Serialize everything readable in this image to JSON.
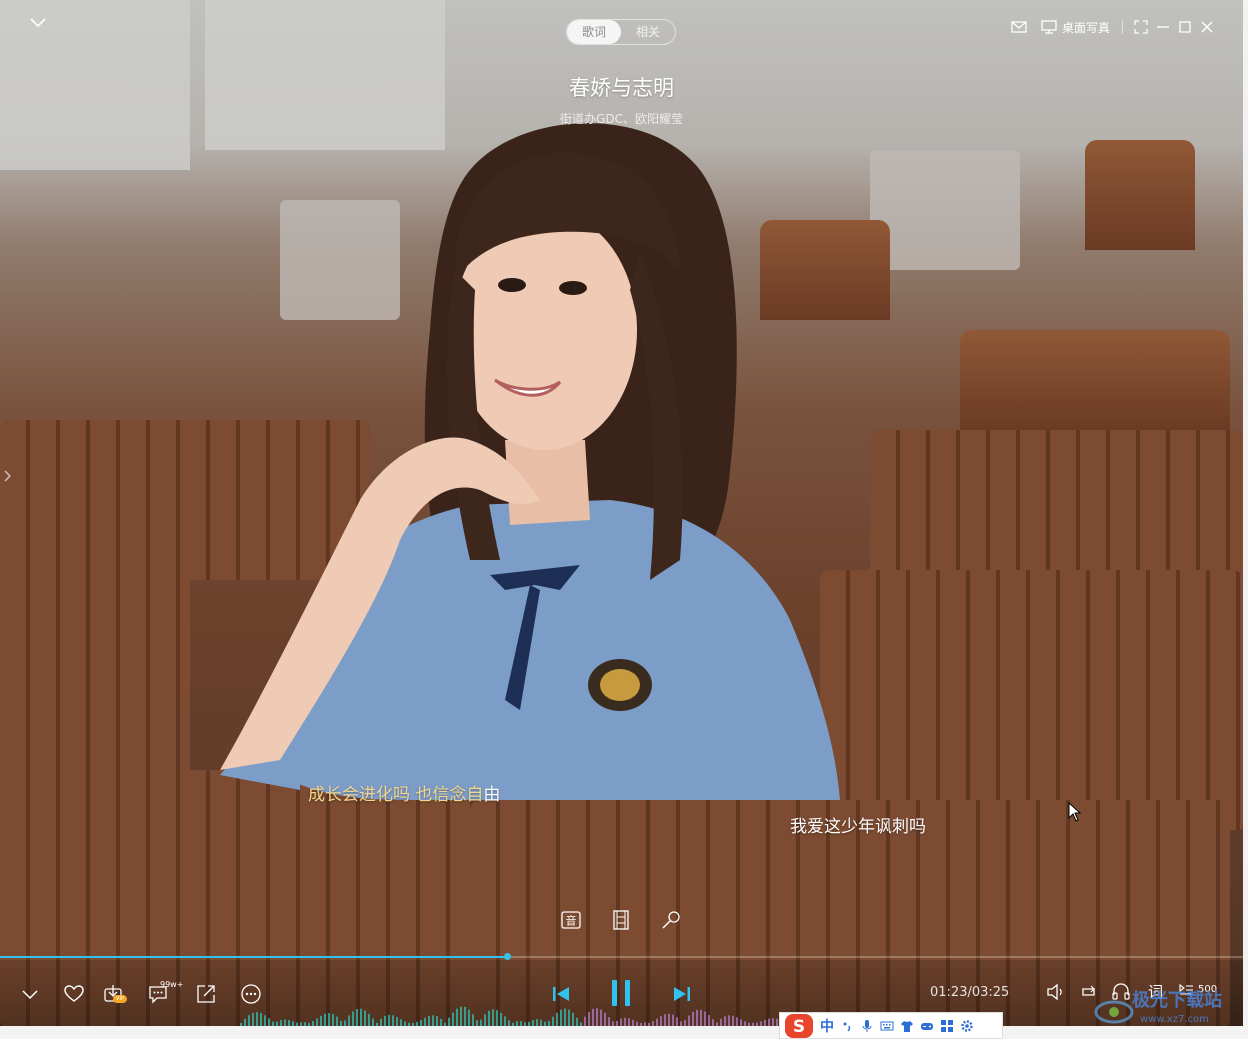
{
  "header": {
    "tabs": [
      {
        "label": "歌词",
        "active": true
      },
      {
        "label": "相关",
        "active": false
      }
    ],
    "desktop_label": "桌面写真"
  },
  "song": {
    "title": "春娇与志明",
    "artist": "街道办GDC、欧阳耀莹"
  },
  "lyrics": {
    "current_highlighted": "成长会进化吗 也信念自",
    "current_rest": "由",
    "next": "我爱这少年讽刺吗"
  },
  "player": {
    "comments_badge": "99w+",
    "download_badge": "VIP",
    "time": "01:23/03:25",
    "lyrics_toggle": "词",
    "queue_count": "500",
    "progress_fraction": 0.408,
    "accent_color": "#31c2f0"
  },
  "ime": {
    "mode_label": "中"
  },
  "watermark": {
    "title": "极光下载站",
    "url": "www.xz7.com"
  }
}
